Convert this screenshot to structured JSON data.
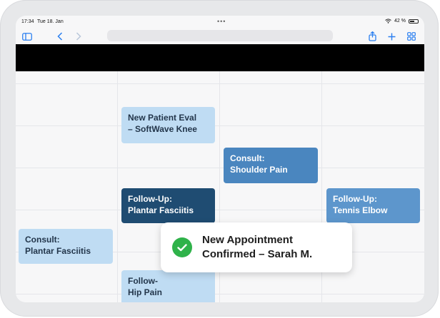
{
  "status_bar": {
    "time": "17:34",
    "date": "Tue 18. Jan",
    "battery": "42 %",
    "icons": [
      "wifi-icon",
      "battery-icon"
    ]
  },
  "toolbar": {
    "icons": [
      "sidebar-icon",
      "back-chevron-icon",
      "forward-chevron-icon",
      "share-icon",
      "add-tab-icon",
      "tabs-grid-icon"
    ]
  },
  "calendar": {
    "appointments": [
      {
        "line1": "New Patient Eval",
        "line2": "– SoftWave Knee",
        "style": "light"
      },
      {
        "line1": "Consult:",
        "line2": "Shoulder Pain",
        "style": "mid"
      },
      {
        "line1": "Follow-Up:",
        "line2": "Plantar Fasciitis",
        "style": "dark"
      },
      {
        "line1": "Follow-Up:",
        "line2": "Tennis Elbow",
        "style": "sky"
      },
      {
        "line1": "Consult:",
        "line2": "Plantar Fasciitis",
        "style": "light"
      },
      {
        "line1": "Follow-",
        "line2": "Hip Pain",
        "style": "light"
      }
    ]
  },
  "toast": {
    "line1": "New Appointment",
    "line2": "Confirmed – Sarah M.",
    "icon": "check-circle-icon"
  },
  "colors": {
    "light": "#bfdcf3",
    "mid": "#4a86bf",
    "dark": "#1f4c72",
    "sky": "#5d96cc",
    "success": "#2fb24a",
    "accent": "#2a7ff0"
  }
}
